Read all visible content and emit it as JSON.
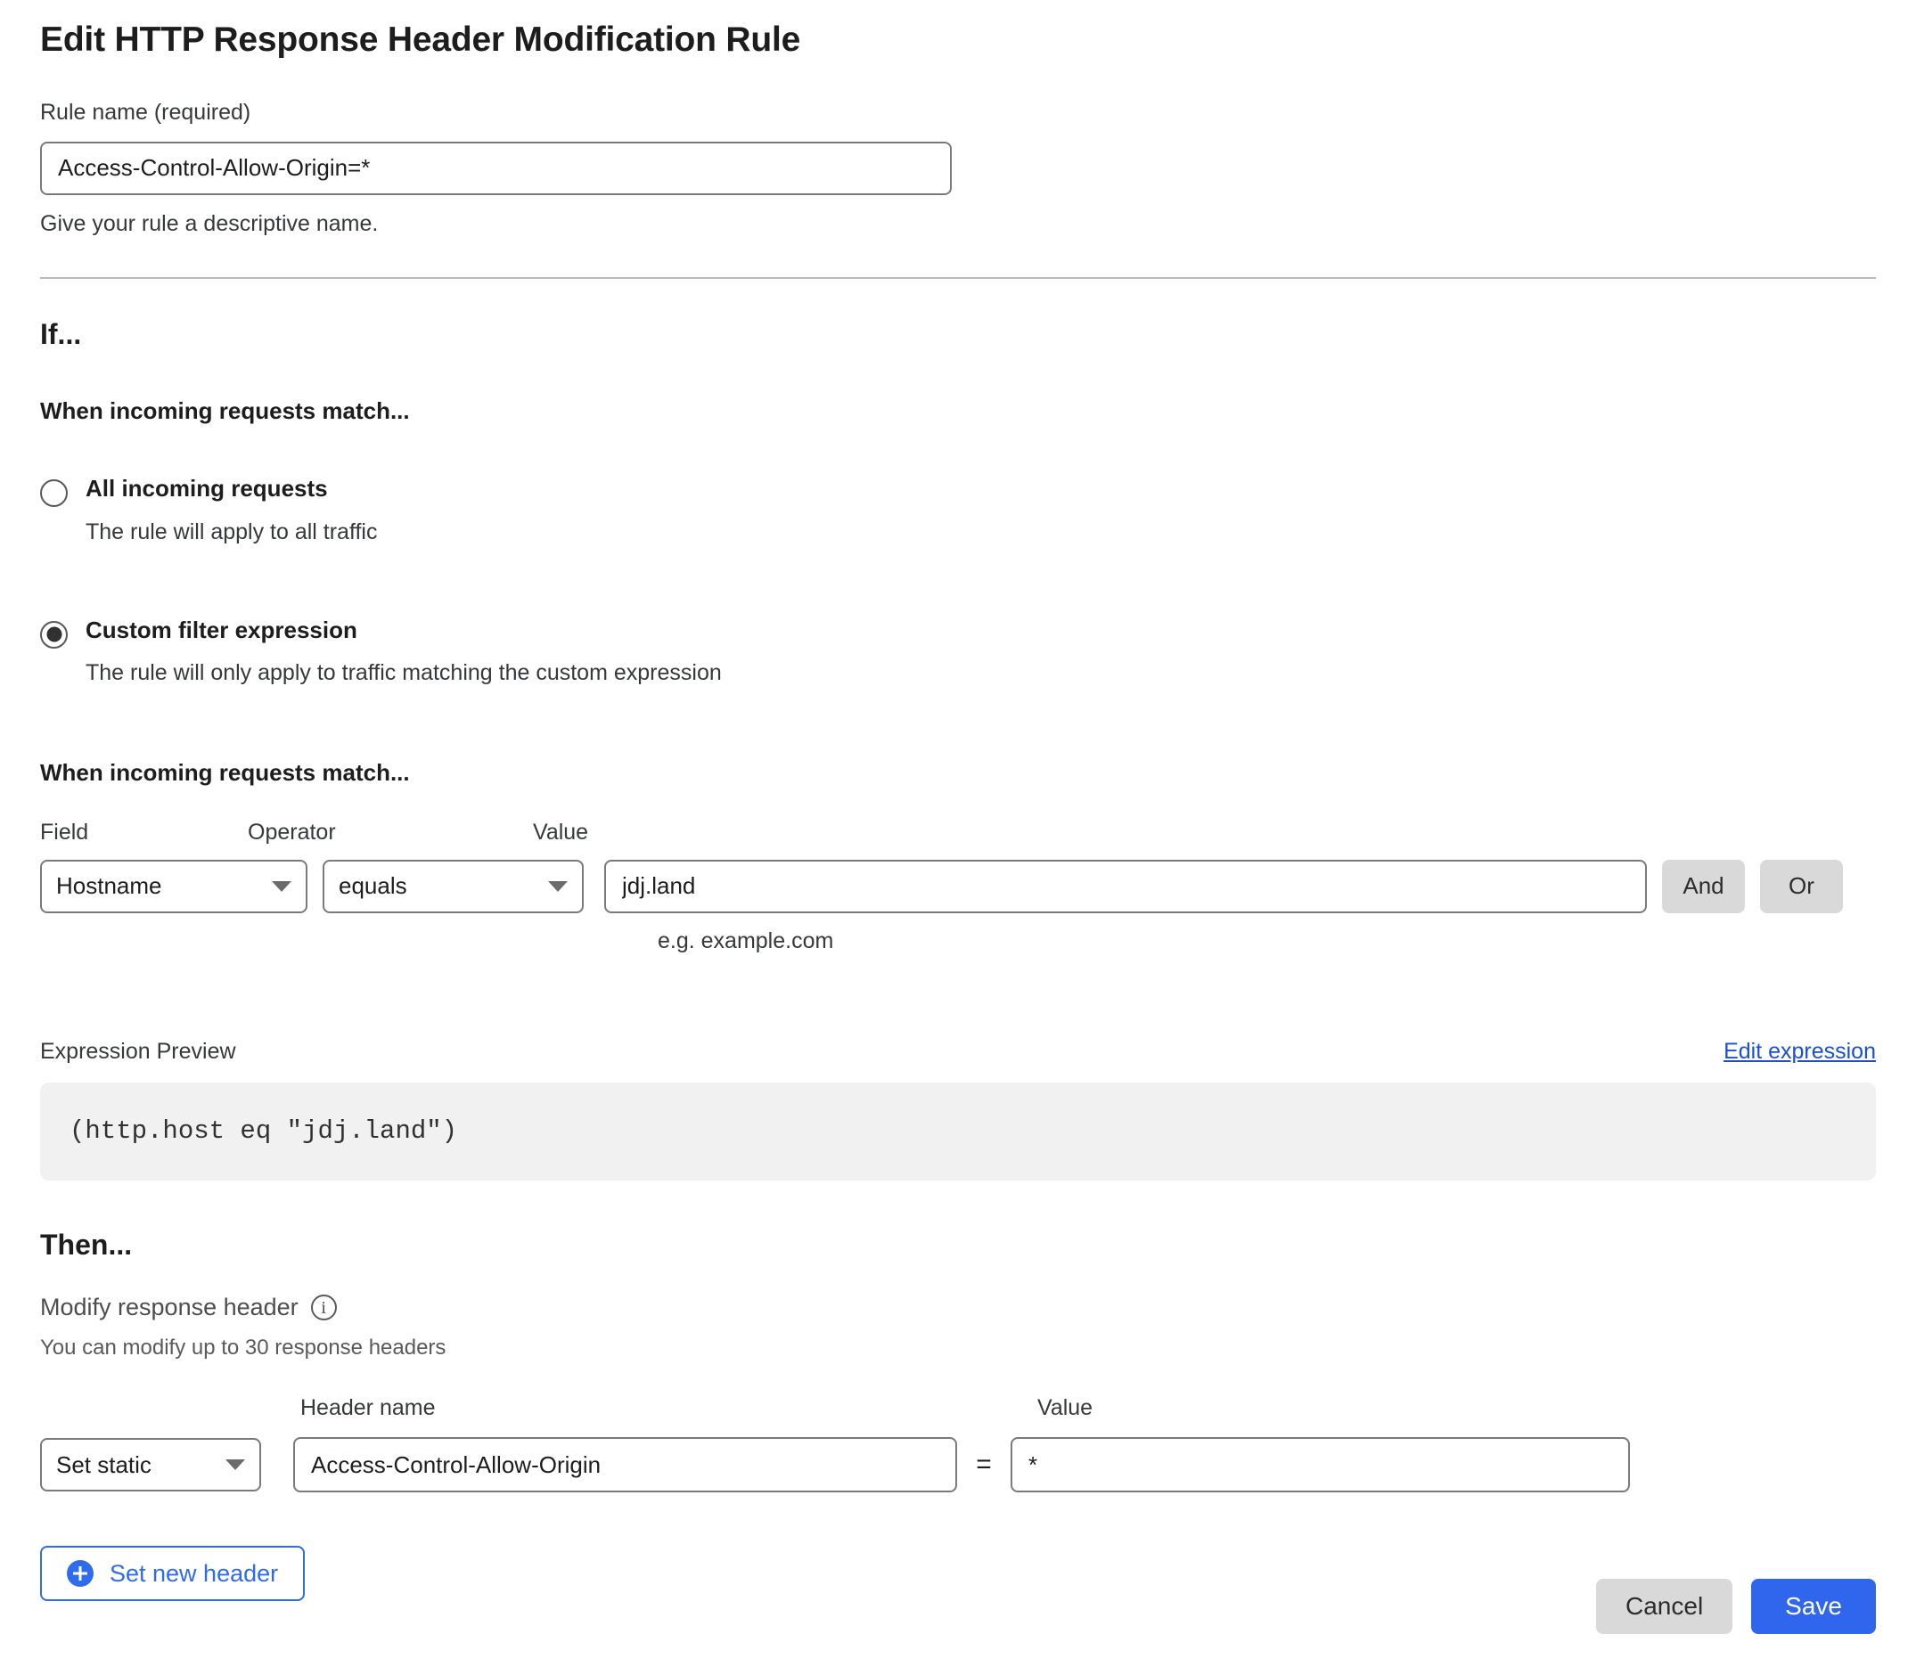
{
  "page_title": "Edit HTTP Response Header Modification Rule",
  "rule_name": {
    "label": "Rule name (required)",
    "value": "Access-Control-Allow-Origin=*",
    "placeholder": "",
    "helper": "Give your rule a descriptive name."
  },
  "if_section": {
    "heading": "If...",
    "match_heading": "When incoming requests match...",
    "options": [
      {
        "title": "All incoming requests",
        "description": "The rule will apply to all traffic",
        "selected": false
      },
      {
        "title": "Custom filter expression",
        "description": "The rule will only apply to traffic matching the custom expression",
        "selected": true
      }
    ]
  },
  "condition": {
    "match_heading": "When incoming requests match...",
    "labels": {
      "field": "Field",
      "operator": "Operator",
      "value": "Value"
    },
    "field_value": "Hostname",
    "operator_value": "equals",
    "value_value": "jdj.land",
    "value_placeholder": "",
    "value_helper": "e.g. example.com",
    "and_label": "And",
    "or_label": "Or"
  },
  "expression": {
    "label": "Expression Preview",
    "edit_link": "Edit expression",
    "code": "(http.host eq \"jdj.land\")"
  },
  "then_section": {
    "heading": "Then...",
    "modify_label": "Modify response header",
    "modify_sub": "You can modify up to 30 response headers",
    "labels": {
      "header_name": "Header name",
      "value": "Value"
    },
    "action_value": "Set static",
    "header_name_value": "Access-Control-Allow-Origin",
    "header_name_placeholder": "",
    "equals": "=",
    "header_value_value": "*",
    "header_value_placeholder": "",
    "set_new_header_label": "Set new header"
  },
  "footer": {
    "cancel_label": "Cancel",
    "save_label": "Save"
  },
  "colors": {
    "accent_blue": "#3066ee",
    "link_blue": "#1a4fd6",
    "neutral_button": "#d9d9d9",
    "code_background": "#f1f1f1",
    "border_gray": "#7a7a7a"
  }
}
